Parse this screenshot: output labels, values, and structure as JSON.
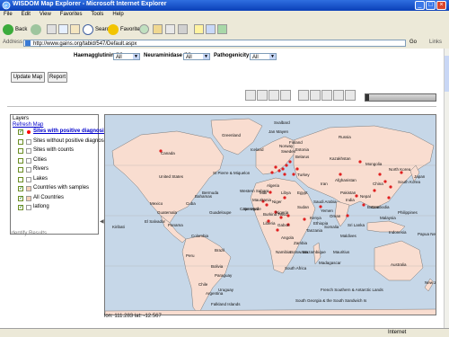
{
  "window": {
    "title": "WISDOM Map Explorer - Microsoft Internet Explorer",
    "minimize": "_",
    "maximize": "□",
    "close": "×"
  },
  "menu": [
    "File",
    "Edit",
    "View",
    "Favorites",
    "Tools",
    "Help"
  ],
  "toolbar": {
    "back": "Back",
    "search": "Search",
    "favorites": "Favorites"
  },
  "address": {
    "label": "Address",
    "url": "http://www.gains.org/tabid/547/Default.aspx",
    "go": "Go",
    "links": "Links"
  },
  "filters": {
    "hemagglutinin_label": "Haemagglutinin (H):",
    "hemagglutinin_value": "All",
    "neuraminidase_label": "Neuraminidase (N):",
    "neuraminidase_value": "All",
    "pathogenicity_label": "Pathogenicity:",
    "pathogenicity_value": "All"
  },
  "buttons": {
    "update_map": "Update Map",
    "report": "Report"
  },
  "layers": {
    "title": "Layers",
    "refresh": "Refresh Map",
    "items": [
      {
        "label": "Sites with positive diagnosis",
        "checked": true,
        "swatch": "#ff0000",
        "link": true
      },
      {
        "label": "Sites without positive diagnosis",
        "checked": false,
        "swatch": "#ffffff",
        "link": false
      },
      {
        "label": "Sites with counts",
        "checked": false,
        "swatch": "#ffffff",
        "link": false
      },
      {
        "label": "Cities",
        "checked": false,
        "swatch": "#ffffff",
        "link": false
      },
      {
        "label": "Rivers",
        "checked": false,
        "swatch": "#ffffff",
        "link": false
      },
      {
        "label": "Lakes",
        "checked": false,
        "swatch": "#ffffff",
        "link": false
      },
      {
        "label": "Countries with samples",
        "checked": true,
        "swatch": "#f7d0b8",
        "link": false
      },
      {
        "label": "All Countries",
        "checked": true,
        "swatch": "#f7d0b8",
        "link": false
      },
      {
        "label": "latlong",
        "checked": true,
        "swatch": "#ffffff",
        "link": false
      }
    ]
  },
  "identify_label": "Identify Results",
  "coordinates": "lon: 111.283  lat: -12.567",
  "status": {
    "zone": "Internet"
  },
  "colors": {
    "ocean": "#c6d7e8",
    "land": "#f9ddd0",
    "border": "#777777",
    "site_marker": "#e02020"
  },
  "map_labels": [
    "Greenland",
    "Svalbard",
    "Jan Mayen",
    "Iceland",
    "Norway",
    "Russia",
    "Canada",
    "United States",
    "Finland",
    "Sweden",
    "Estonia",
    "Belarus",
    "Kazakhstan",
    "Mongolia",
    "North Korea",
    "Japan",
    "China",
    "South Korea",
    "Turkey",
    "Iran",
    "Afghanistan",
    "Pakistan",
    "India",
    "Nepal",
    "Burma",
    "Saudi Arabia",
    "Oman",
    "Yemen",
    "Sudan",
    "Egypt",
    "Libya",
    "Niger",
    "Mali",
    "Algeria",
    "Western Sahara",
    "Mauritania",
    "Senegal",
    "Burkina Faso",
    "Nigeria",
    "Liberia",
    "Gabon",
    "Angola",
    "Zambia",
    "Namibia",
    "Botswana",
    "South Africa",
    "Madagascar",
    "Mozambique",
    "Tanzania",
    "Kenya",
    "Ethiopia",
    "Somalia",
    "Mexico",
    "Guatemala",
    "El Salvador",
    "Panama",
    "Cuba",
    "Bahamas",
    "Guadeloupe",
    "Colombia",
    "Peru",
    "Brazil",
    "Bolivia",
    "Paraguay",
    "Chile",
    "Argentina",
    "Uruguay",
    "Falkland Islands",
    "Papua New Guinea",
    "Philippines",
    "Indonesia",
    "Malaysia",
    "Australia",
    "New Zealand",
    "Sri Lanka",
    "Maldives",
    "Mauritius",
    "French Southern & Antarctic Lands",
    "South Georgia & the South Sandwich Is",
    "St Pierre & Miquelon",
    "Bermuda",
    "Kiribati",
    "Cape Verde",
    "Cambodia"
  ]
}
